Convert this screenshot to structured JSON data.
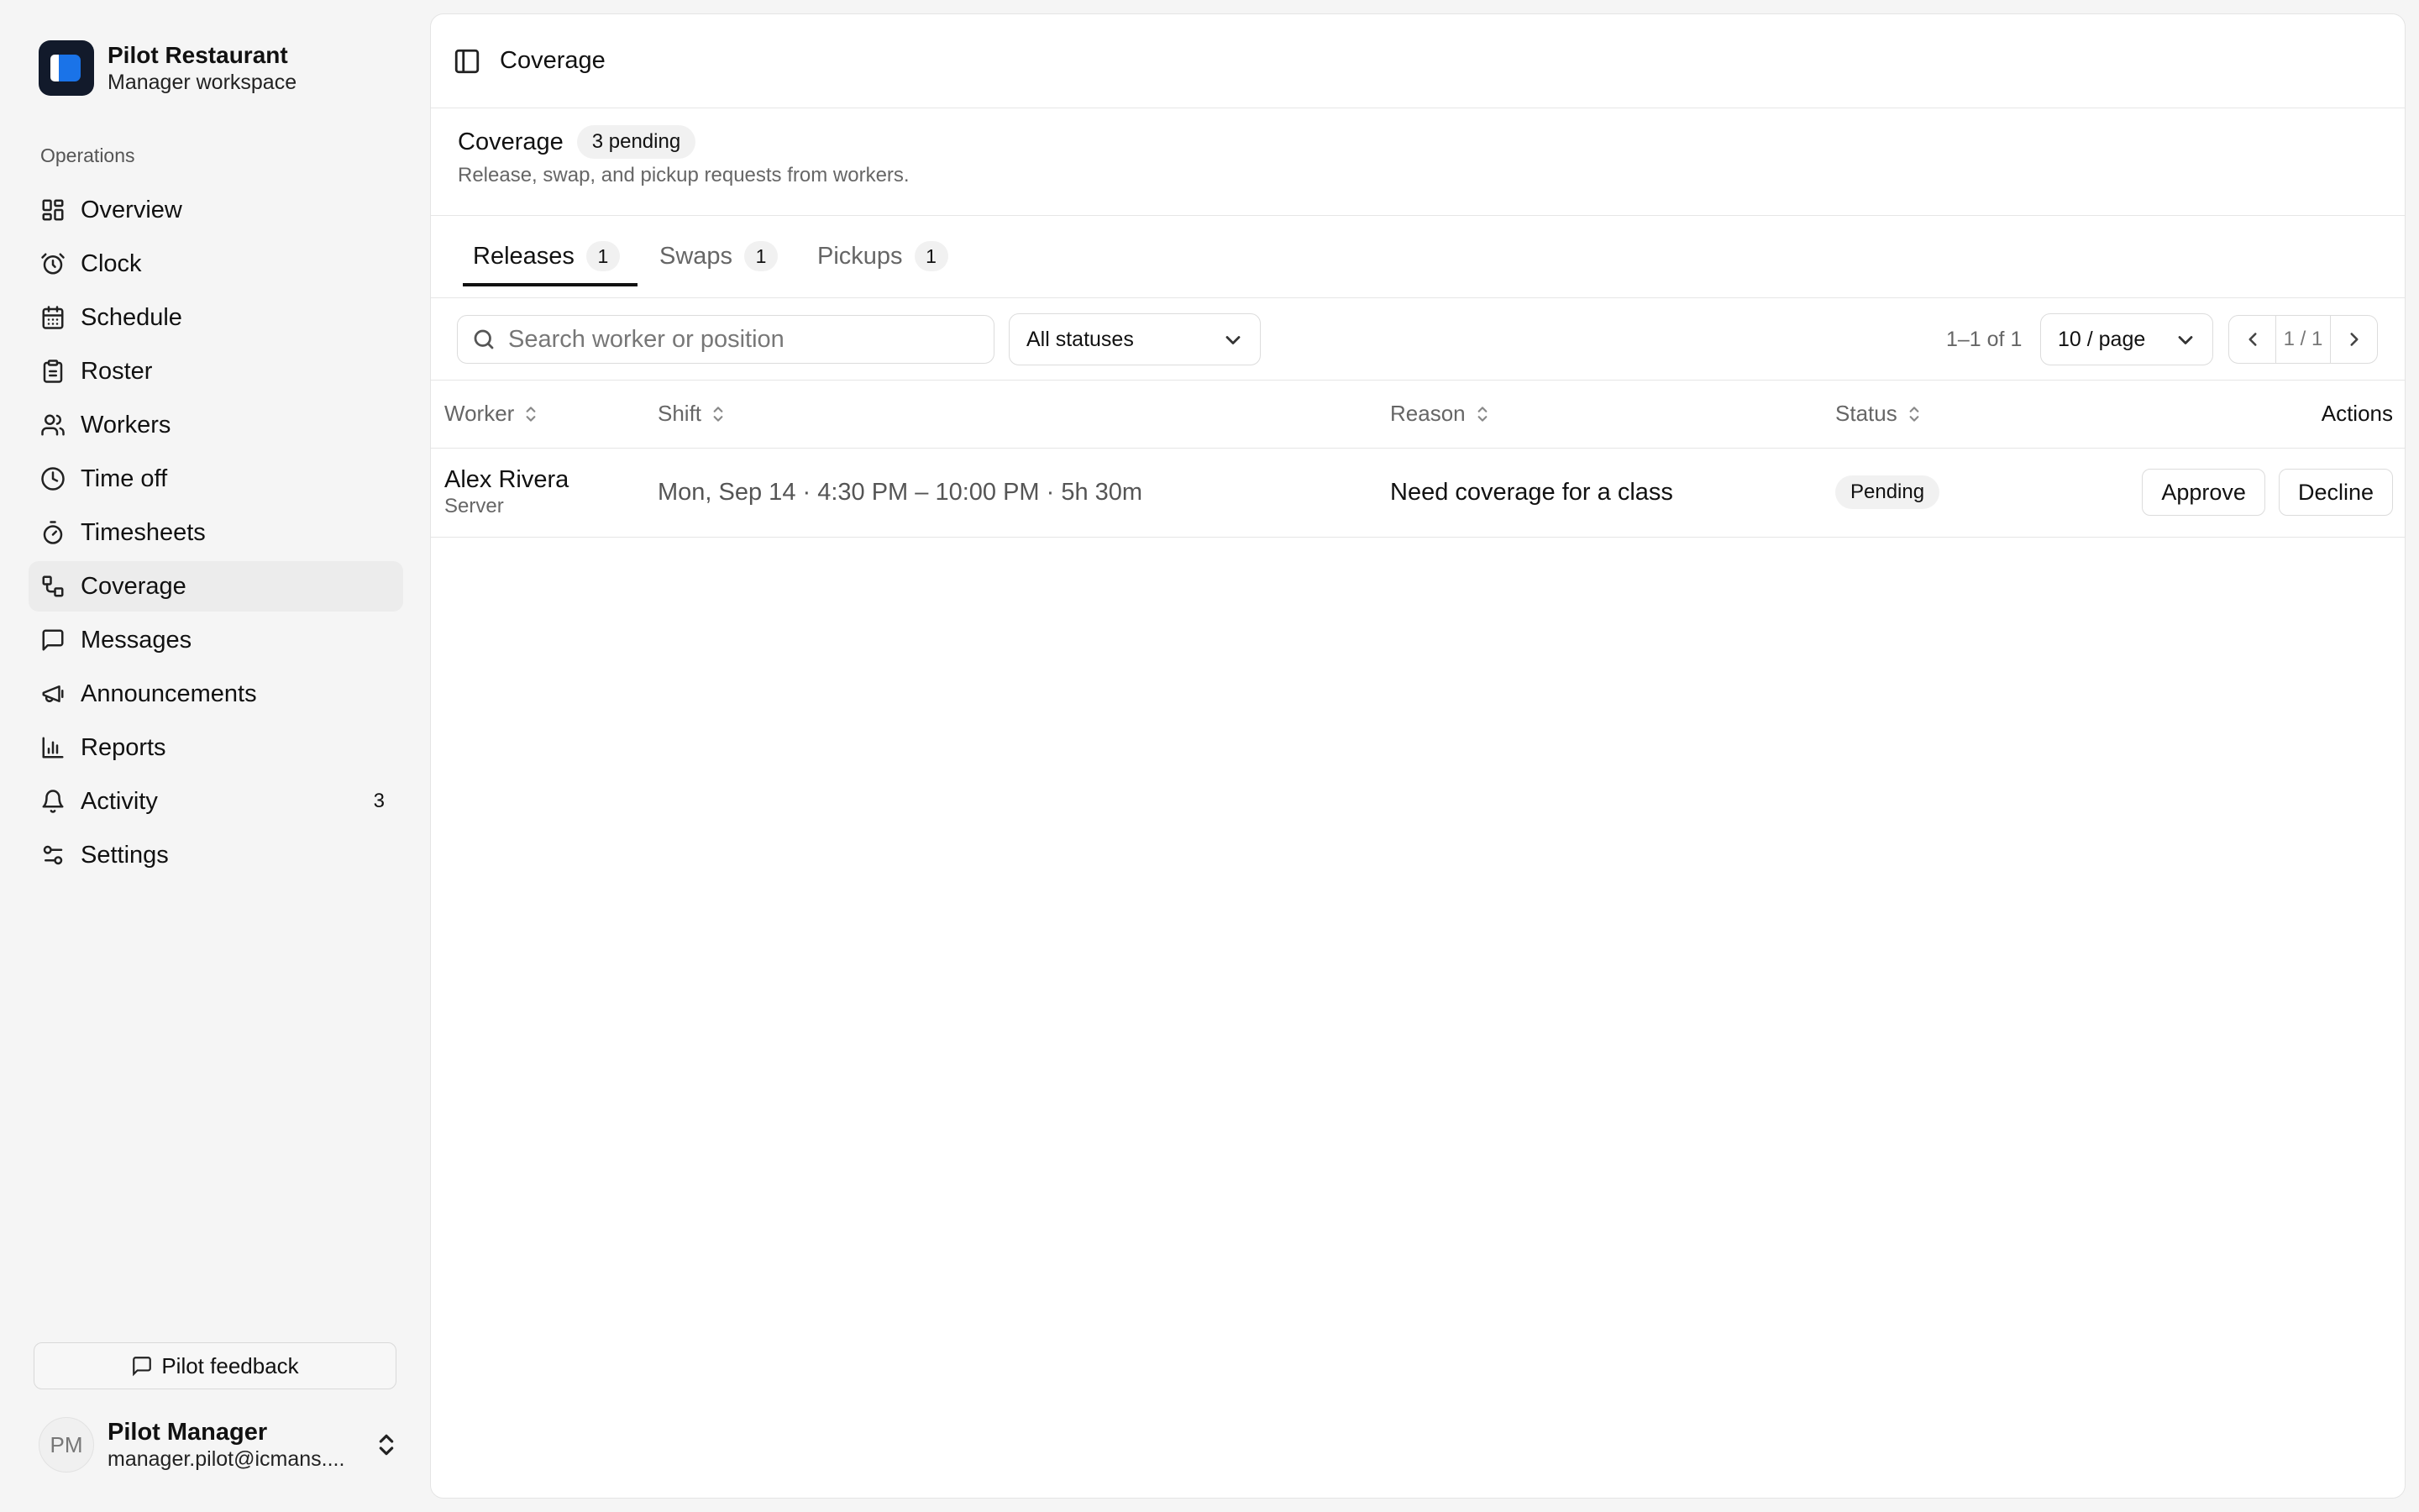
{
  "brand": {
    "name": "Pilot Restaurant",
    "subtitle": "Manager workspace"
  },
  "sidebar": {
    "section_label": "Operations",
    "items": [
      {
        "label": "Overview",
        "icon": "grid-icon"
      },
      {
        "label": "Clock",
        "icon": "alarm-clock-icon"
      },
      {
        "label": "Schedule",
        "icon": "calendar-icon"
      },
      {
        "label": "Roster",
        "icon": "clipboard-icon"
      },
      {
        "label": "Workers",
        "icon": "users-icon"
      },
      {
        "label": "Time off",
        "icon": "clock-icon"
      },
      {
        "label": "Timesheets",
        "icon": "timer-icon"
      },
      {
        "label": "Coverage",
        "icon": "coverage-icon",
        "active": true
      },
      {
        "label": "Messages",
        "icon": "message-icon"
      },
      {
        "label": "Announcements",
        "icon": "megaphone-icon"
      },
      {
        "label": "Reports",
        "icon": "bar-chart-icon"
      },
      {
        "label": "Activity",
        "icon": "bell-icon",
        "count": "3"
      },
      {
        "label": "Settings",
        "icon": "sliders-icon"
      }
    ],
    "feedback_label": "Pilot feedback",
    "user": {
      "initials": "PM",
      "name": "Pilot Manager",
      "email": "manager.pilot@icmans...."
    }
  },
  "topbar": {
    "title": "Coverage"
  },
  "page": {
    "title": "Coverage",
    "pending_badge": "3 pending",
    "subtitle": "Release, swap, and pickup requests from workers."
  },
  "tabs": [
    {
      "label": "Releases",
      "count": "1",
      "active": true
    },
    {
      "label": "Swaps",
      "count": "1"
    },
    {
      "label": "Pickups",
      "count": "1"
    }
  ],
  "toolbar": {
    "search_placeholder": "Search worker or position",
    "search_value": "",
    "status_filter": "All statuses",
    "range_text": "1–1 of 1",
    "page_size": "10 / page",
    "page_indicator": "1 / 1"
  },
  "table": {
    "columns": [
      "Worker",
      "Shift",
      "Reason",
      "Status",
      "Actions"
    ],
    "rows": [
      {
        "worker": "Alex Rivera",
        "role": "Server",
        "shift": "Mon, Sep 14 · 4:30 PM – 10:00 PM · 5h 30m",
        "reason": "Need coverage for a class",
        "status": "Pending",
        "approve_label": "Approve",
        "decline_label": "Decline"
      }
    ]
  },
  "colors": {
    "brand_logo_bg": "#121a2b",
    "brand_accent": "#1a73e8",
    "active_nav_bg": "#ececec"
  }
}
